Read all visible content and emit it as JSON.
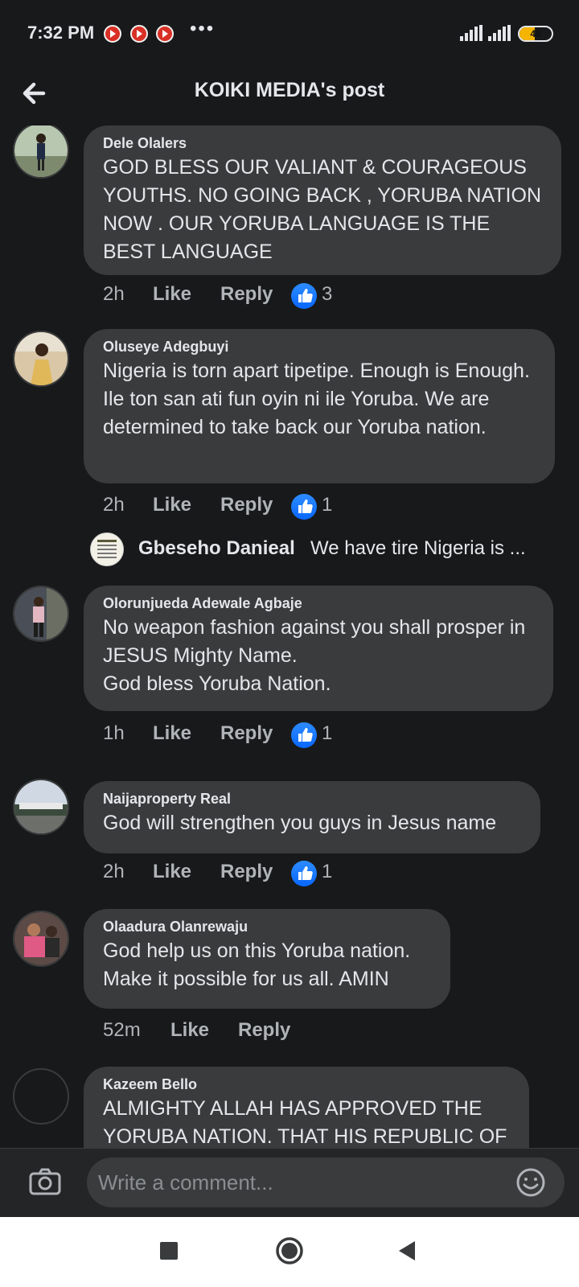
{
  "status_bar": {
    "time": "7:32 PM",
    "more": "•••",
    "battery": "48",
    "battery_level": 0.48
  },
  "header": {
    "title": "KOIKI MEDIA's post"
  },
  "comments": [
    {
      "author": "Dele Olalers",
      "text": "GOD BLESS OUR VALIANT & COURAGEOUS YOUTHS. NO GOING BACK , YORUBA NATION NOW . OUR YORUBA LANGUAGE IS THE BEST LANGUAGE",
      "time": "2h",
      "like": "Like",
      "reply": "Reply",
      "reactions": "3"
    },
    {
      "author": "Oluseye Adegbuyi",
      "text": "Nigeria is torn apart tipetipe.  Enough is Enough.  Ile ton san ati fun oyin ni ile Yoruba. We are determined to take back our Yoruba nation.",
      "time": "2h",
      "like": "Like",
      "reply": "Reply",
      "reactions": "1"
    },
    {
      "author": "Olorunjueda Adewale Agbaje",
      "text": "No weapon fashion against you shall prosper in JESUS Mighty Name.\nGod bless Yoruba Nation.",
      "time": "1h",
      "like": "Like",
      "reply": "Reply",
      "reactions": "1"
    },
    {
      "author": "Naijaproperty Real",
      "text": "God will strengthen you guys in Jesus name",
      "time": "2h",
      "like": "Like",
      "reply": "Reply",
      "reactions": "1"
    },
    {
      "author": "Olaadura Olanrewaju",
      "text": "God help us on this Yoruba nation.\nMake it possible for us all. AMIN",
      "time": "52m",
      "like": "Like",
      "reply": "Reply",
      "reactions": ""
    },
    {
      "author": "Kazeem Bello",
      "text": "ALMIGHTY ALLAH HAS APPROVED THE YORUBA NATION. THAT HIS REPUBLIC OF",
      "time": "",
      "like": "",
      "reply": "",
      "reactions": ""
    }
  ],
  "reply_preview": {
    "author": "Gbeseho Danieal",
    "text": "We have tire Nigeria is ..."
  },
  "composer": {
    "placeholder": "Write a comment..."
  },
  "colors": {
    "background": "#18191a",
    "bubble": "#3a3b3c",
    "like_blue": "#0866ff"
  },
  "icons": [
    "back-arrow-icon",
    "like-thumb-icon",
    "camera-icon",
    "emoji-icon",
    "nav-square-icon",
    "nav-circle-icon",
    "nav-triangle-icon"
  ]
}
